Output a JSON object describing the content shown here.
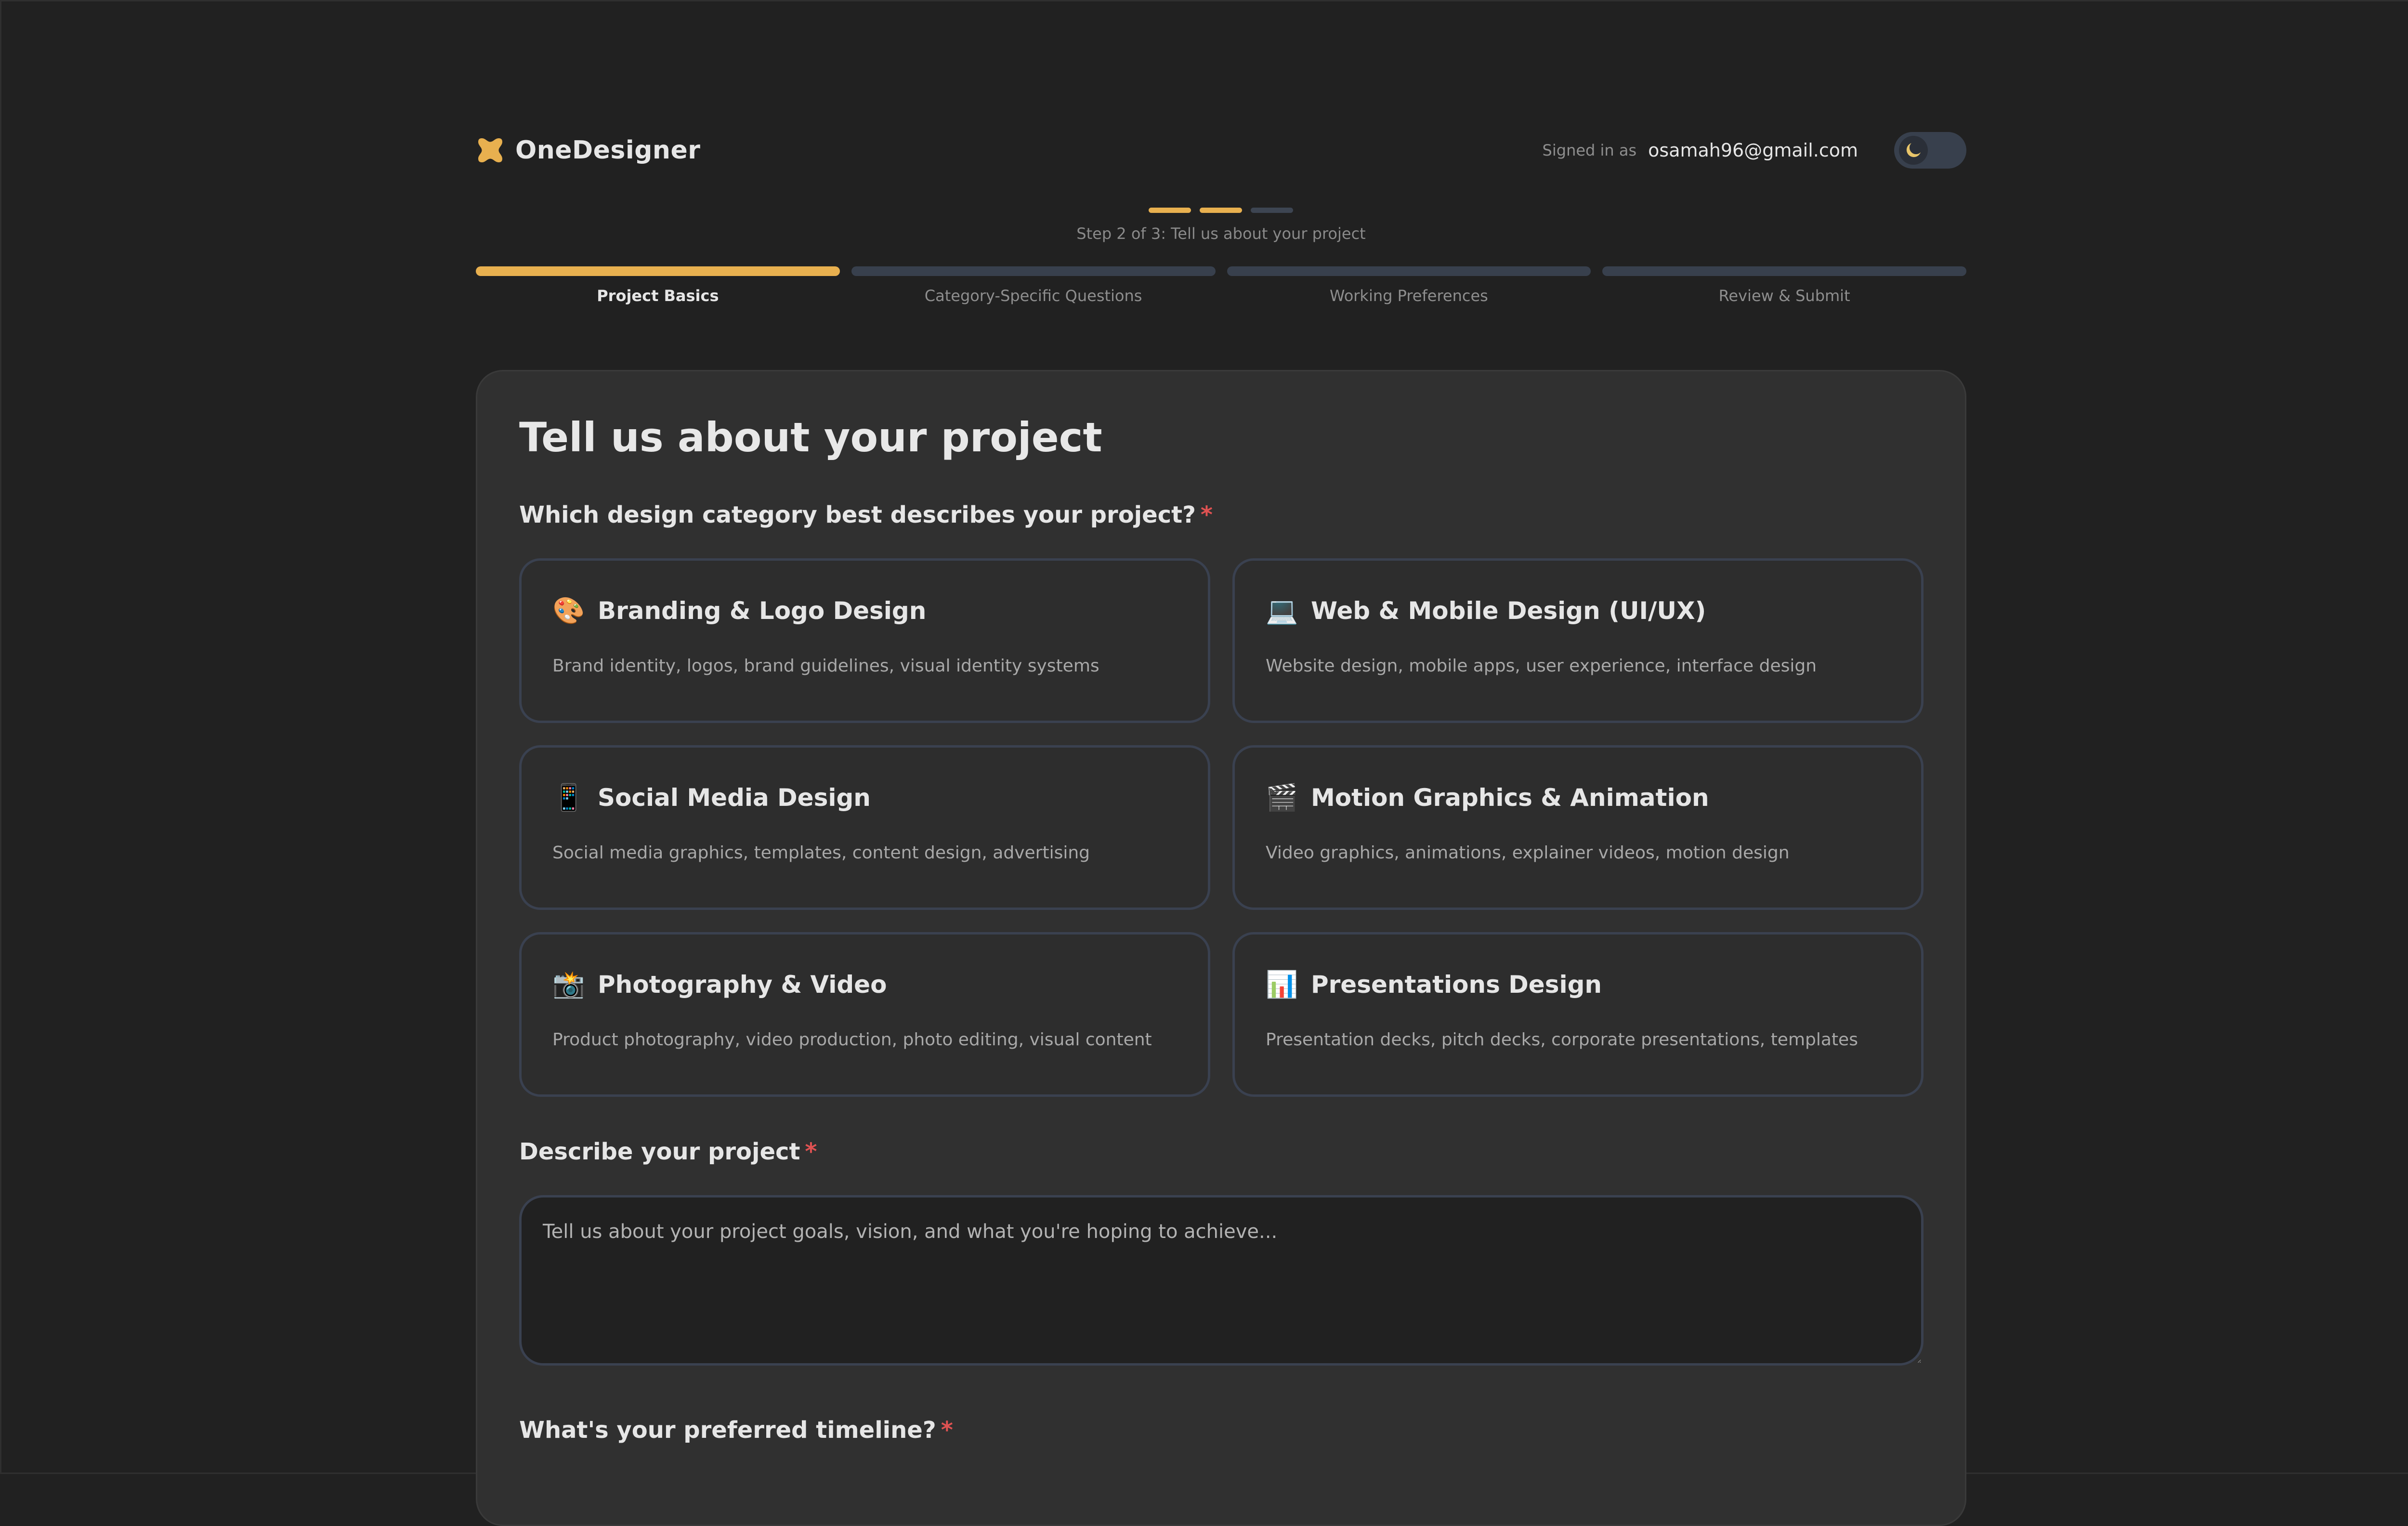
{
  "app": {
    "brand": "OneDesigner",
    "signed_in_label": "Signed in as",
    "user_email": "osamah96@gmail.com",
    "theme_icon": "moon-icon"
  },
  "stepper": {
    "step_text": "Step 2 of 3: Tell us about your project",
    "dots": [
      {
        "state": "active"
      },
      {
        "state": "active"
      },
      {
        "state": "inactive"
      }
    ],
    "tabs": [
      {
        "label": "Project Basics",
        "state": "active"
      },
      {
        "label": "Category-Specific Questions",
        "state": "inactive"
      },
      {
        "label": "Working Preferences",
        "state": "inactive"
      },
      {
        "label": "Review & Submit",
        "state": "inactive"
      }
    ]
  },
  "form": {
    "title": "Tell us about your project",
    "category_question": "Which design category best describes your project?",
    "required_mark": "*",
    "categories": [
      {
        "icon": "🎨",
        "icon_name": "palette-icon",
        "title": "Branding & Logo Design",
        "desc": "Brand identity, logos, brand guidelines, visual identity systems"
      },
      {
        "icon": "💻",
        "icon_name": "laptop-icon",
        "title": "Web & Mobile Design (UI/UX)",
        "desc": "Website design, mobile apps, user experience, interface design"
      },
      {
        "icon": "📱",
        "icon_name": "mobile-phone-icon",
        "title": "Social Media Design",
        "desc": "Social media graphics, templates, content design, advertising"
      },
      {
        "icon": "🎬",
        "icon_name": "clapper-board-icon",
        "title": "Motion Graphics & Animation",
        "desc": "Video graphics, animations, explainer videos, motion design"
      },
      {
        "icon": "📸",
        "icon_name": "camera-flash-icon",
        "title": "Photography & Video",
        "desc": "Product photography, video production, photo editing, visual content"
      },
      {
        "icon": "📊",
        "icon_name": "bar-chart-icon",
        "title": "Presentations Design",
        "desc": "Presentation decks, pitch decks, corporate presentations, templates"
      }
    ],
    "describe_label": "Describe your project",
    "describe_value": "",
    "describe_placeholder": "Tell us about your project goals, vision, and what you're hoping to achieve...",
    "timeline_label": "What's your preferred timeline?"
  },
  "colors": {
    "accent": "#e8b04f",
    "required": "#e05252",
    "background": "#212121",
    "card": "#303030"
  }
}
